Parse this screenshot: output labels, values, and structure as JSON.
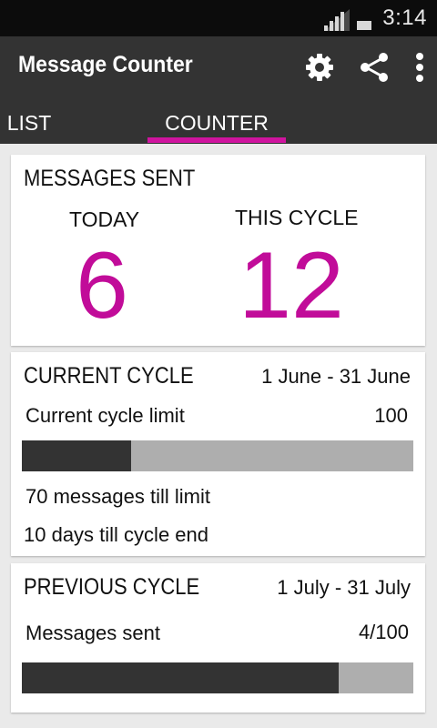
{
  "status": {
    "time": "3:14"
  },
  "appbar": {
    "title": "Message Counter",
    "icons": [
      "gear-icon",
      "share-icon",
      "overflow-menu-icon"
    ]
  },
  "tabs": [
    {
      "label": "LIST",
      "selected": false
    },
    {
      "label": "COUNTER",
      "selected": true
    }
  ],
  "colors": {
    "accent": "#d0149f",
    "number": "#c10c99",
    "bar_fill": "#333333",
    "bar_track": "#aeaeae"
  },
  "messages_sent": {
    "title": "MESSAGES SENT",
    "today_label": "TODAY",
    "today_value": "6",
    "cycle_label": "THIS CYCLE",
    "cycle_value": "12"
  },
  "current_cycle": {
    "title": "CURRENT CYCLE",
    "dates": "1 June - 31 June",
    "limit_label": "Current cycle limit",
    "limit_value": "100",
    "progress": 0.28,
    "remaining_text": "70 messages till limit",
    "days_text": "10 days till cycle end"
  },
  "previous_cycle": {
    "title": "PREVIOUS CYCLE",
    "dates": "1 July - 31 July",
    "sent_label": "Messages sent",
    "sent_value": "4/100",
    "progress": 0.81
  }
}
